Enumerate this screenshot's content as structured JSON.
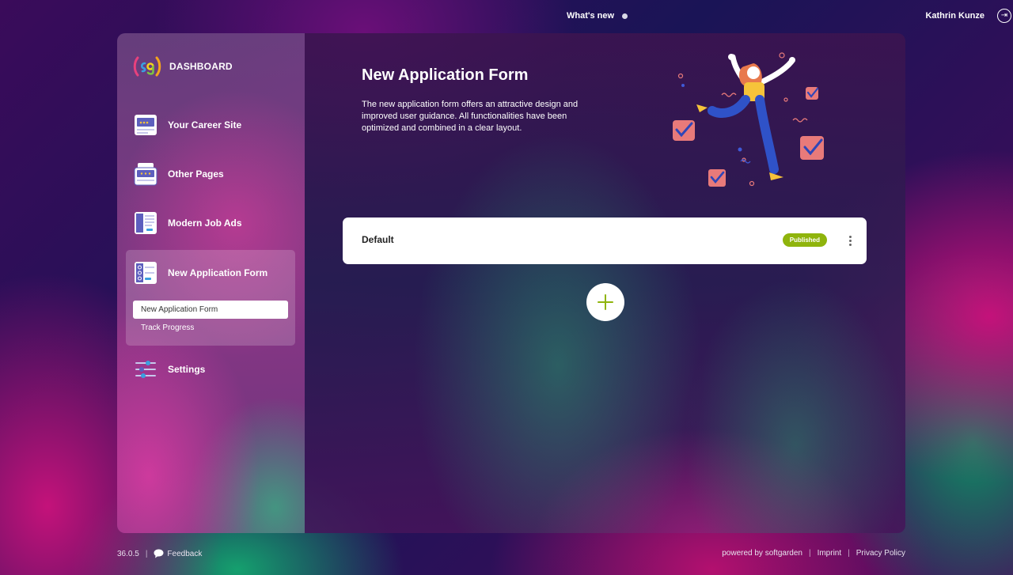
{
  "header": {
    "whats_new": "What's new",
    "user_name": "Kathrin Kunze",
    "logout_glyph": "⇥"
  },
  "sidebar": {
    "logo_text": "DASHBOARD",
    "items": [
      {
        "label": "Your Career Site",
        "icon": "career-site-icon"
      },
      {
        "label": "Other Pages",
        "icon": "other-pages-icon"
      },
      {
        "label": "Modern Job Ads",
        "icon": "job-ads-icon"
      },
      {
        "label": "New Application Form",
        "icon": "application-form-icon",
        "active": true,
        "subitems": [
          {
            "label": "New Application Form",
            "active": true
          },
          {
            "label": "Track Progress",
            "active": false
          }
        ]
      },
      {
        "label": "Settings",
        "icon": "settings-sliders-icon"
      }
    ]
  },
  "main": {
    "title": "New Application Form",
    "description": "The new application form offers an attractive design and improved user guidance. All functionalities have been optimized and combined in a clear layout.",
    "forms": [
      {
        "name": "Default",
        "status": "Published"
      }
    ],
    "add_glyph": "+"
  },
  "footer": {
    "version": "36.0.5",
    "feedback": "Feedback",
    "powered_by": "powered by softgarden",
    "imprint": "Imprint",
    "privacy": "Privacy Policy",
    "separator": "|"
  },
  "colors": {
    "published_badge": "#8fb40c",
    "accent_green": "#8fb40c"
  }
}
